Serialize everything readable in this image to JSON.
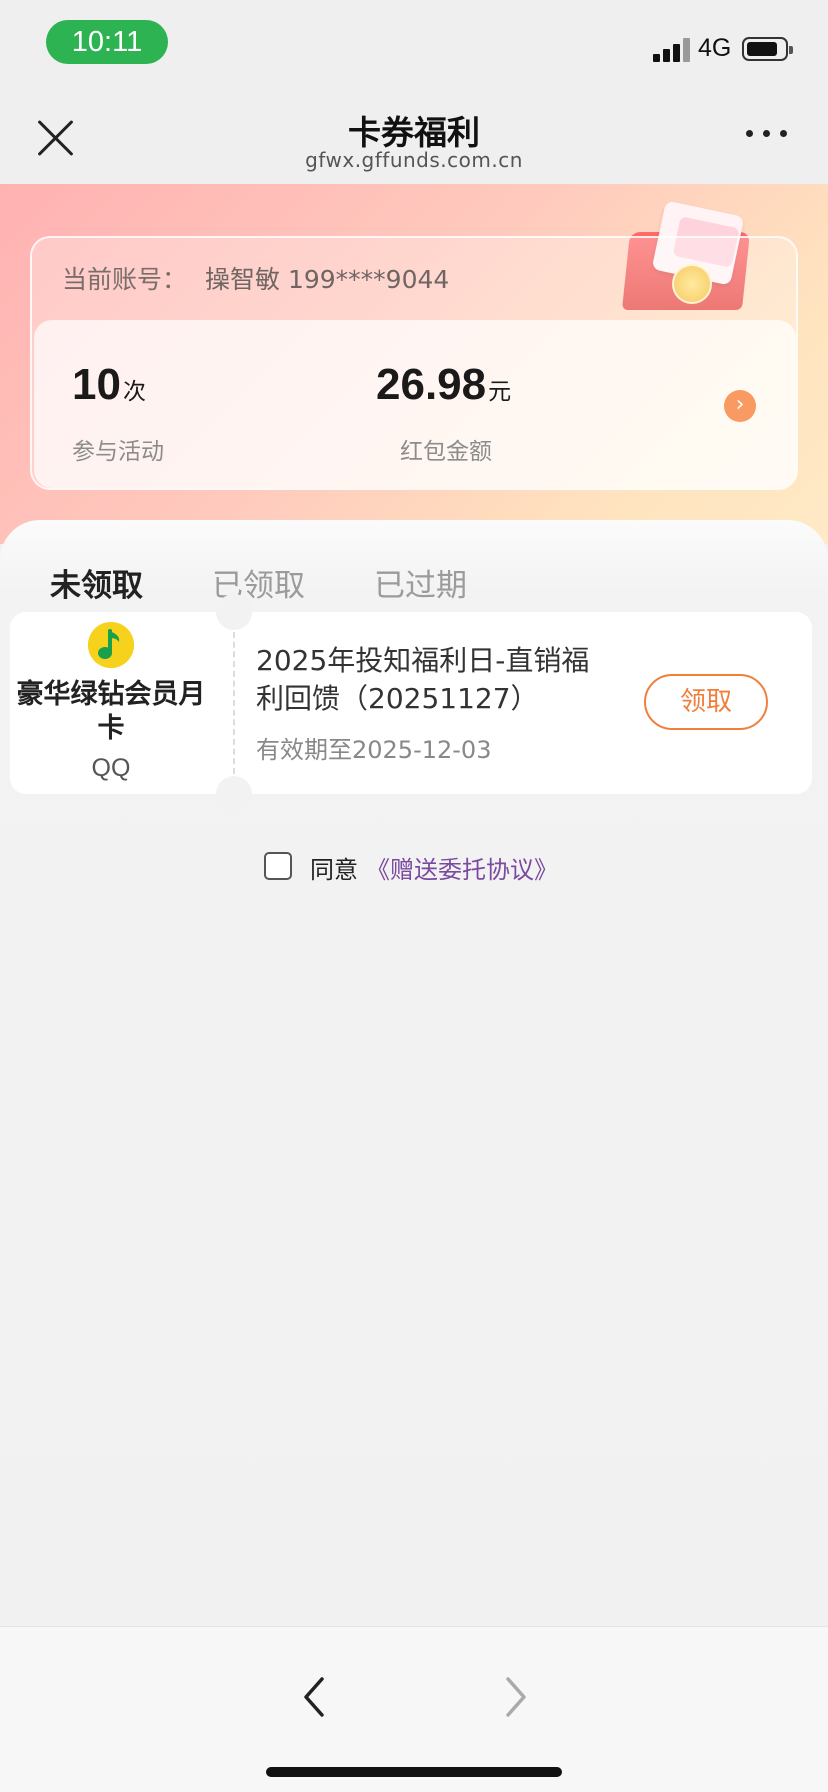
{
  "status_bar": {
    "time": "10:11",
    "network": "4G"
  },
  "nav": {
    "title": "卡券福利",
    "subtitle": "gfwx.gffunds.com.cn",
    "close_icon": "close-icon",
    "more_icon": "more-icon"
  },
  "account": {
    "label": "当前账号：",
    "name": "操智敏 199****9044",
    "participations_value": "10",
    "participations_unit": "次",
    "participations_label": "参与活动",
    "amount_value": "26.98",
    "amount_unit": "元",
    "amount_label": "红包金额",
    "arrow": "›"
  },
  "tabs": [
    {
      "label": "未领取",
      "active": true
    },
    {
      "label": "已领取",
      "active": false
    },
    {
      "label": "已过期",
      "active": false
    }
  ],
  "coupon": {
    "name": "豪华绿钻会员月卡",
    "brand": "QQ",
    "title": "2025年投知福利日-直销福利回馈（20251127）",
    "expiry": "有效期至2025-12-03",
    "claim_label": "领取",
    "icon": "qq-music-icon"
  },
  "agreement": {
    "text": "同意",
    "link": "《赠送委托协议》"
  },
  "colors": {
    "accent": "#f07f3c",
    "time_pill": "#2db352",
    "link": "#7a4aa0"
  }
}
